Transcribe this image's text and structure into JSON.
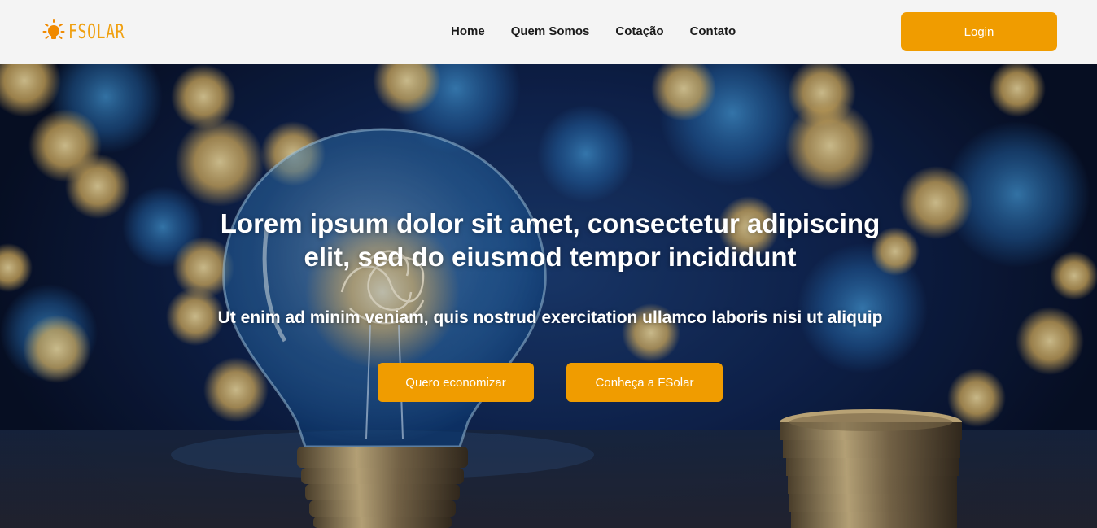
{
  "brand": {
    "name": "FSOLAR",
    "logo_icon": "sun-bulb-icon",
    "color": "#f0a010"
  },
  "nav": {
    "items": [
      {
        "label": "Home"
      },
      {
        "label": "Quem Somos"
      },
      {
        "label": "Cotação"
      },
      {
        "label": "Contato"
      }
    ],
    "login_label": "Login"
  },
  "hero": {
    "title_line1": "Lorem ipsum dolor sit amet, consectetur adipiscing",
    "title_line2": "elit, sed do eiusmod tempor incididunt",
    "subtitle": "Ut enim ad minim veniam, quis nostrud exercitation ullamco laboris nisi ut aliquip",
    "primary_cta": "Quero economizar",
    "secondary_cta": "Conheça a FSolar",
    "background_image": "light-bulb-with-coins-bokeh"
  },
  "colors": {
    "accent": "#f09c00",
    "navbar_bg": "#f4f4f4"
  }
}
